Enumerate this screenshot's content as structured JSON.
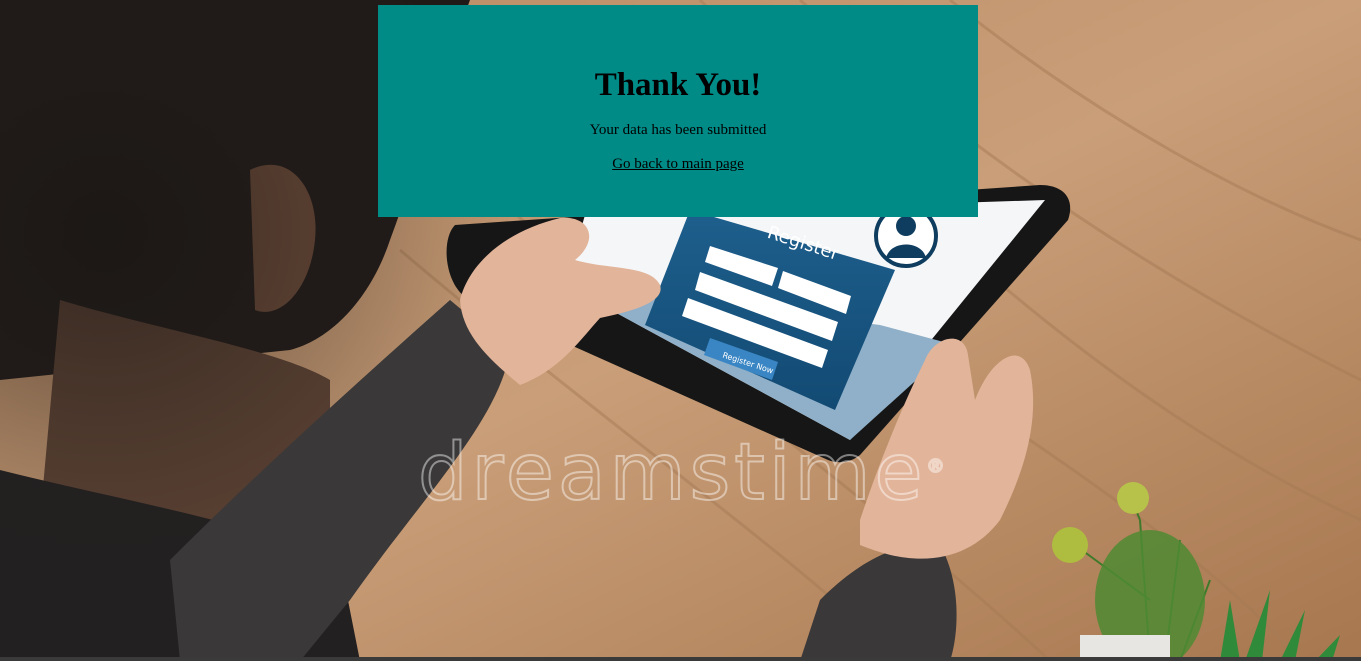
{
  "card": {
    "title": "Thank You!",
    "message": "Your data has been submitted",
    "link_text": "Go back to main page"
  },
  "background": {
    "tablet_form_title": "Register",
    "tablet_button_label": "Register Now",
    "watermark_text": "dreamstime",
    "watermark_mark": "®"
  },
  "colors": {
    "card_bg": "#008b87",
    "text": "#000000"
  }
}
